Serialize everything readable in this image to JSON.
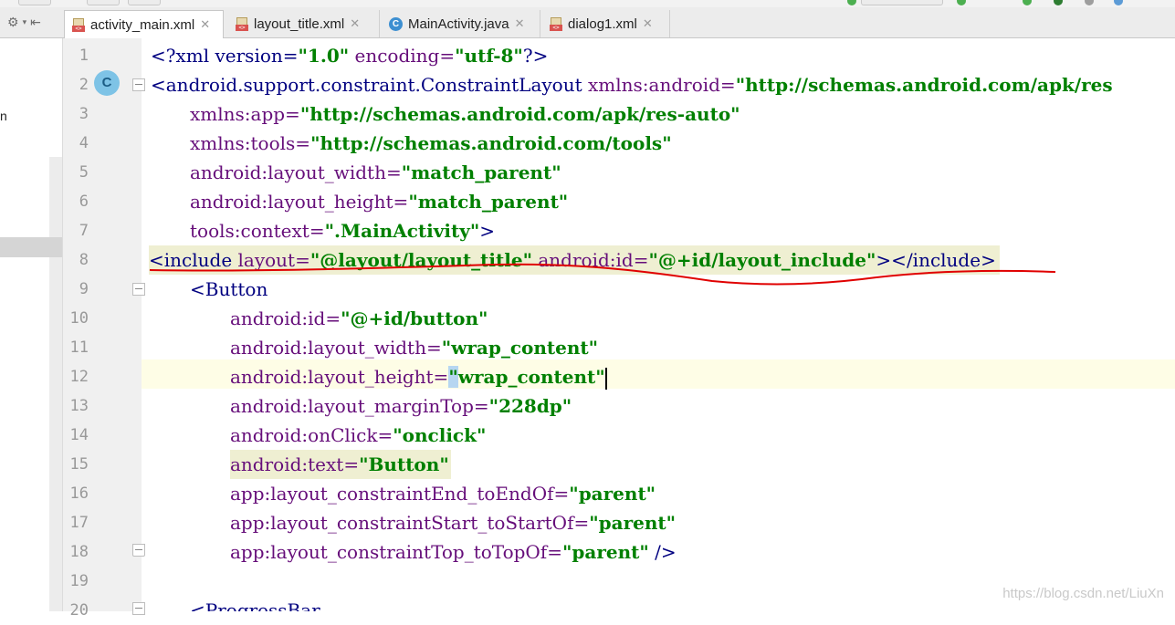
{
  "tabs": [
    {
      "label": "activity_main.xml",
      "icon": "xml-file-icon",
      "active": true
    },
    {
      "label": "layout_title.xml",
      "icon": "xml-file-icon",
      "active": false
    },
    {
      "label": "MainActivity.java",
      "icon": "java-class-icon",
      "active": false
    },
    {
      "label": "dialog1.xml",
      "icon": "xml-file-icon",
      "active": false
    }
  ],
  "tab_close_glyph": "✕",
  "class_badge": "C",
  "sidebar_fragment": "n",
  "line_numbers": [
    "1",
    "2",
    "3",
    "4",
    "5",
    "6",
    "7",
    "8",
    "9",
    "10",
    "11",
    "12",
    "13",
    "14",
    "15",
    "16",
    "17",
    "18",
    "19",
    "20"
  ],
  "code": {
    "l1": {
      "t1": "<?xml version=",
      "v1": "\"1.0\"",
      "t2": " encoding=",
      "v2": "\"utf-8\"",
      "t3": "?>"
    },
    "l2": {
      "tag": "<android.support.constraint.ConstraintLayout",
      "attr": " xmlns:android=",
      "val": "\"http://schemas.android.com/apk/res"
    },
    "l3": {
      "attr": "xmlns:app=",
      "val": "\"http://schemas.android.com/apk/res-auto\""
    },
    "l4": {
      "attr": "xmlns:tools=",
      "val": "\"http://schemas.android.com/tools\""
    },
    "l5": {
      "attr": "android:layout_width=",
      "val": "\"match_parent\""
    },
    "l6": {
      "attr": "android:layout_height=",
      "val": "\"match_parent\""
    },
    "l7": {
      "attr": "tools:context=",
      "val": "\".MainActivity\"",
      "close": ">"
    },
    "l8": {
      "open": "<include",
      "a1": " layout=",
      "v1": "\"@layout/layout_title\"",
      "a2": " android:id=",
      "v2": "\"@+id/layout_include\"",
      "close": "></include>"
    },
    "l9": {
      "tag": "<Button"
    },
    "l10": {
      "attr": "android:id=",
      "val": "\"@+id/button\""
    },
    "l11": {
      "attr": "android:layout_width=",
      "val": "\"wrap_content\""
    },
    "l12": {
      "attr": "android:layout_height=",
      "q1": "\"",
      "val": "wrap_content\""
    },
    "l13": {
      "attr": "android:layout_marginTop=",
      "val": "\"228dp\""
    },
    "l14": {
      "attr": "android:onClick=",
      "val": "\"onclick\""
    },
    "l15": {
      "attr": "android:text=",
      "val": "\"Button\""
    },
    "l16": {
      "attr": "app:layout_constraintEnd_toEndOf=",
      "val": "\"parent\""
    },
    "l17": {
      "attr": "app:layout_constraintStart_toStartOf=",
      "val": "\"parent\""
    },
    "l18": {
      "attr": "app:layout_constraintTop_toTopOf=",
      "val": "\"parent\"",
      "close": " />"
    },
    "l20": {
      "tag": "<ProgressBar"
    }
  },
  "watermark": "https://blog.csdn.net/LiuXn",
  "colors": {
    "tag": "#000080",
    "attr": "#660e7a",
    "value": "#008000",
    "annotation": "#e00000",
    "caret_line": "#fefde6"
  }
}
